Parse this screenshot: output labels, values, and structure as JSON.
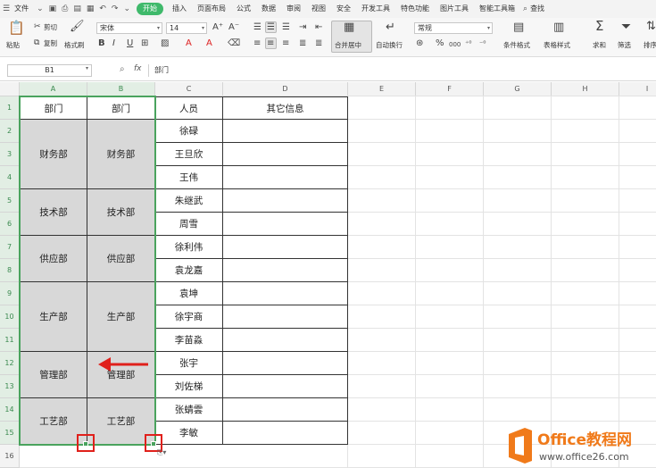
{
  "menubar": {
    "file": "文件",
    "start": "开始",
    "tabs": [
      "插入",
      "页面布局",
      "公式",
      "数据",
      "审阅",
      "视图",
      "安全",
      "开发工具",
      "特色功能",
      "图片工具",
      "智能工具箱"
    ],
    "search": "查找"
  },
  "ribbon": {
    "paste": "粘贴",
    "cut": "剪切",
    "copy": "复制",
    "format_painter": "格式刷",
    "font_name": "宋体",
    "font_size": "14",
    "merge_center": "合并居中",
    "wrap_text": "自动换行",
    "number_format": "常规",
    "conditional_format": "条件格式",
    "table_style": "表格样式",
    "sum": "求和",
    "filter": "筛选",
    "sort": "排序",
    "bold": "B",
    "italic": "I",
    "underline": "U",
    "font_color": "A",
    "fill_color": "A",
    "percent": "%",
    "thousands": "000"
  },
  "formula_bar": {
    "name_box": "B1",
    "fx": "fx",
    "content": "部门"
  },
  "sheet": {
    "columns": [
      "A",
      "B",
      "C",
      "D",
      "E",
      "F",
      "G",
      "H",
      "I"
    ],
    "rows": [
      "1",
      "2",
      "3",
      "4",
      "5",
      "6",
      "7",
      "8",
      "9",
      "10",
      "11",
      "12",
      "13",
      "14",
      "15",
      "16"
    ],
    "header": {
      "a": "部门",
      "b": "部门",
      "c": "人员",
      "d": "其它信息"
    },
    "groups": [
      {
        "dept": "财务部",
        "span": 3
      },
      {
        "dept": "技术部",
        "span": 2
      },
      {
        "dept": "供应部",
        "span": 2
      },
      {
        "dept": "生产部",
        "span": 3
      },
      {
        "dept": "管理部",
        "span": 2
      },
      {
        "dept": "工艺部",
        "span": 2
      }
    ],
    "people": [
      "徐碌",
      "王旦欣",
      "王伟",
      "朱继武",
      "周雪",
      "徐利伟",
      "袁龙嘉",
      "袁坤",
      "徐宇商",
      "李苗淼",
      "张宇",
      "刘佐梯",
      "张蜻雲",
      "李敏"
    ]
  },
  "watermark": {
    "brand": "Office教程网",
    "url": "www.office26.com"
  },
  "colors": {
    "accent": "#3fb96b",
    "selection": "#4aa35e",
    "highlight": "#e0201b",
    "merged_fill": "#d8d8d8",
    "watermark_orange": "#f07a1a"
  }
}
